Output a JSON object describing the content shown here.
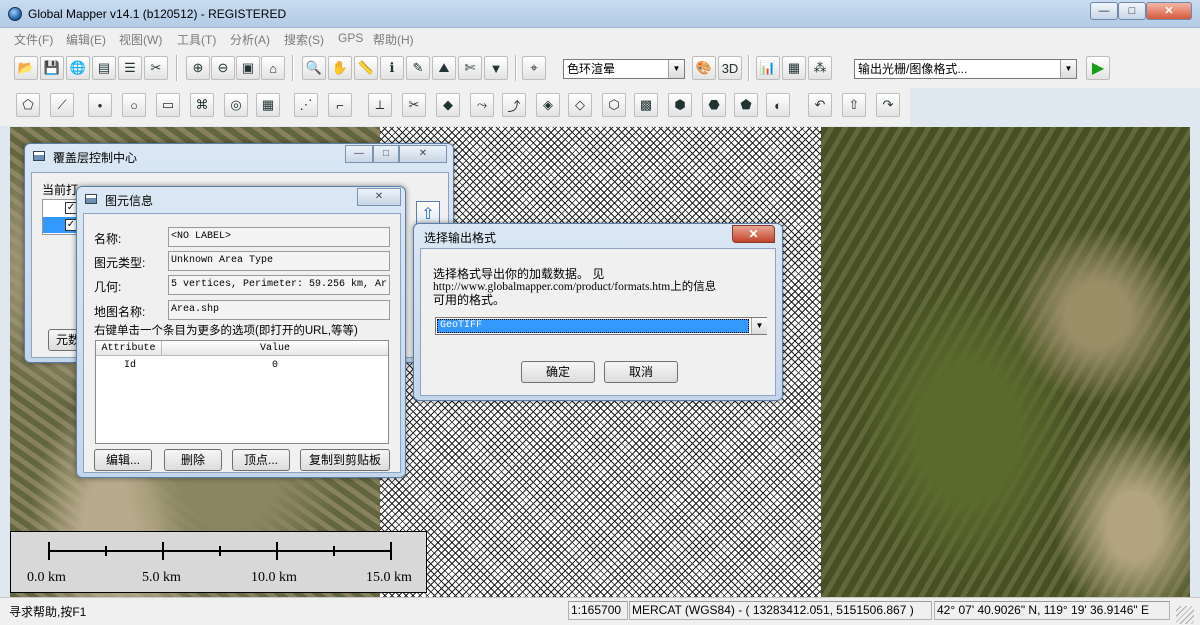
{
  "window": {
    "title": "Global Mapper v14.1 (b120512) - REGISTERED",
    "minimize": "—",
    "maximize": "□",
    "close": "✕"
  },
  "menu": [
    {
      "label": "文件(F)"
    },
    {
      "label": "编辑(E)"
    },
    {
      "label": "视图(W)"
    },
    {
      "label": "工具(T)"
    },
    {
      "label": "分析(A)"
    },
    {
      "label": "搜索(S)"
    },
    {
      "label": "GPS"
    },
    {
      "label": "帮助(H)"
    }
  ],
  "toolbar": {
    "shader_select": "色环渲晕",
    "export_select": "输出光栅/图像格式..."
  },
  "scale_bar": {
    "labels": [
      "0.0 km",
      "5.0 km",
      "10.0 km",
      "15.0 km"
    ]
  },
  "status": {
    "help": "寻求帮助,按F1",
    "scale": "1:165700",
    "projection": "MERCAT (WGS84) - ( 13283412.051, 5151506.867 )",
    "latlon": "42° 07' 40.9026\" N, 119° 19' 36.9146\" E"
  },
  "overlay_dialog": {
    "title": "覆盖层控制中心",
    "label": "当前打",
    "meta_button": "元数"
  },
  "feature_info": {
    "title": "图元信息",
    "name_label": "名称:",
    "name_value": "<NO LABEL>",
    "type_label": "图元类型:",
    "type_value": "Unknown Area Type",
    "geom_label": "几何:",
    "geom_value": "5 vertices, Perimeter: 59.256 km, Ar",
    "map_label": "地图名称:",
    "map_value": "Area.shp",
    "hint": "右键单击一个条目为更多的选项(即打开的URL,等等)",
    "table": {
      "headers": [
        "Attribute",
        "Value"
      ],
      "rows": [
        {
          "attribute": "Id",
          "value": "0"
        }
      ]
    },
    "buttons": {
      "edit": "编辑...",
      "delete": "删除",
      "vertices": "顶点...",
      "copy": "复制到剪贴板"
    }
  },
  "export_dialog": {
    "title": "选择输出格式",
    "message_line1": "选择格式导出你的加载数据。 见",
    "message_line2": "http://www.globalmapper.com/product/formats.htm上的信息",
    "message_line3": "可用的格式。",
    "format_value": "GeoTIFF",
    "ok": "确定",
    "cancel": "取消"
  }
}
